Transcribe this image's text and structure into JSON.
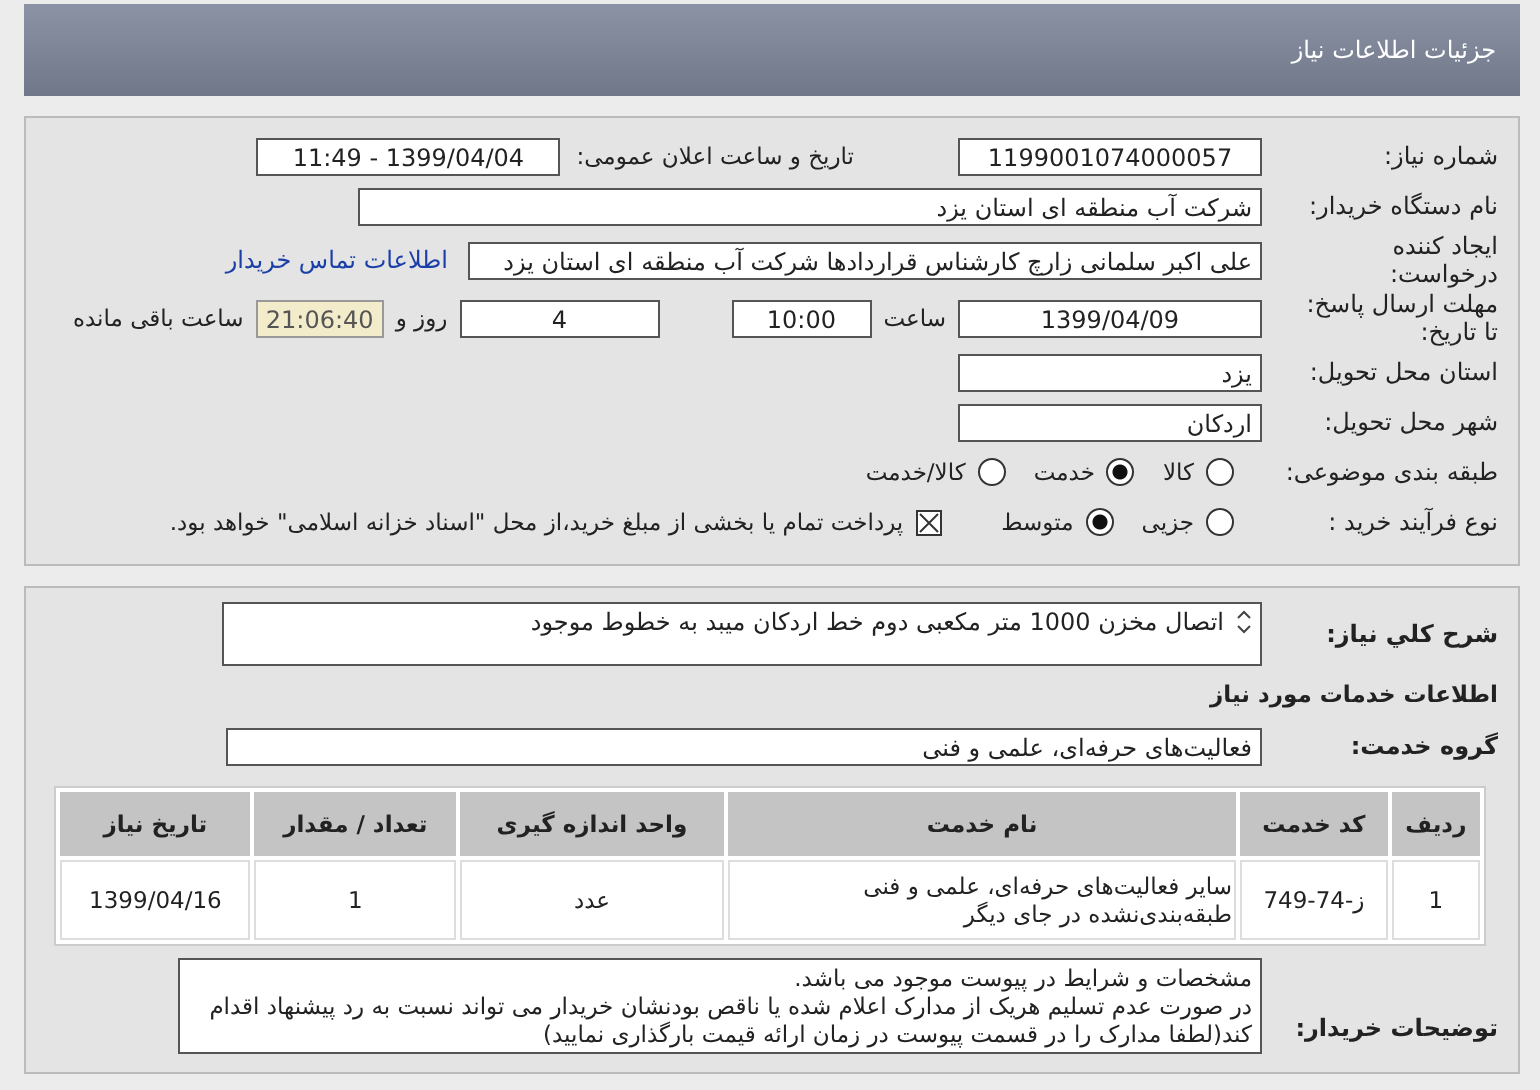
{
  "header": {
    "title": "جزئیات اطلاعات نیاز"
  },
  "need": {
    "number_label": "شماره نیاز:",
    "number": "1199001074000057",
    "announce_label": "تاریخ و ساعت اعلان عمومی:",
    "announce": "1399/04/04 - 11:49"
  },
  "buyer": {
    "label": "نام دستگاه خریدار:",
    "value": "شرکت آب منطقه ای استان یزد"
  },
  "creator": {
    "label": "ایجاد کننده درخواست:",
    "value": "علی اکبر سلمانی زارچ کارشناس قراردادها شرکت آب منطقه ای استان یزد",
    "contact_link": "اطلاعات تماس خریدار"
  },
  "deadline": {
    "label": "مهلت ارسال پاسخ: تا تاریخ:",
    "date": "1399/04/09",
    "time_label": "ساعت",
    "time": "10:00",
    "days": "4",
    "days_label": "روز و",
    "remaining": "21:06:40",
    "remaining_label": "ساعت باقی مانده"
  },
  "province": {
    "label": "استان محل تحویل:",
    "value": "یزد"
  },
  "city": {
    "label": "شهر محل تحویل:",
    "value": "اردکان"
  },
  "category": {
    "label": "طبقه بندی موضوعی:",
    "options": [
      {
        "label": "کالا",
        "selected": false
      },
      {
        "label": "خدمت",
        "selected": true
      },
      {
        "label": "کالا/خدمت",
        "selected": false
      }
    ]
  },
  "process": {
    "label": "نوع فرآیند خرید :",
    "options": [
      {
        "label": "جزیی",
        "selected": false
      },
      {
        "label": "متوسط",
        "selected": true
      }
    ],
    "payment": {
      "checked": true,
      "text": "پرداخت تمام یا بخشی از مبلغ خرید،از محل \"اسناد خزانه اسلامی\" خواهد بود."
    }
  },
  "description": {
    "label": "شرح کلي نياز:",
    "value": "اتصال مخزن 1000 متر مکعبی دوم خط اردکان میبد به خطوط موجود"
  },
  "services_title": "اطلاعات خدمات مورد نیاز",
  "service_group": {
    "label": "گروه خدمت:",
    "value": "فعالیت‌های حرفه‌ای، علمی و فنی"
  },
  "table": {
    "columns": [
      "ردیف",
      "کد خدمت",
      "نام خدمت",
      "واحد اندازه گیری",
      "تعداد / مقدار",
      "تاریخ نیاز"
    ],
    "rows": [
      [
        "1",
        "ز-74-749",
        "سایر فعالیت‌های حرفه‌ای، علمی و فنی طبقه‌بندی‌نشده در جای دیگر",
        "عدد",
        "1",
        "1399/04/16"
      ]
    ]
  },
  "buyer_notes": {
    "label": "توضیحات خریدار:",
    "lines": [
      "مشخصات و شرایط در پیوست موجود می باشد.",
      "در صورت عدم تسلیم هریک از مدارک اعلام شده یا ناقص بودنشان خریدار می تواند نسبت به رد پیشنهاد اقدام کند(لطفا مدارک را در قسمت پیوست در زمان ارائه قیمت بارگذاری نمایید)"
    ]
  }
}
